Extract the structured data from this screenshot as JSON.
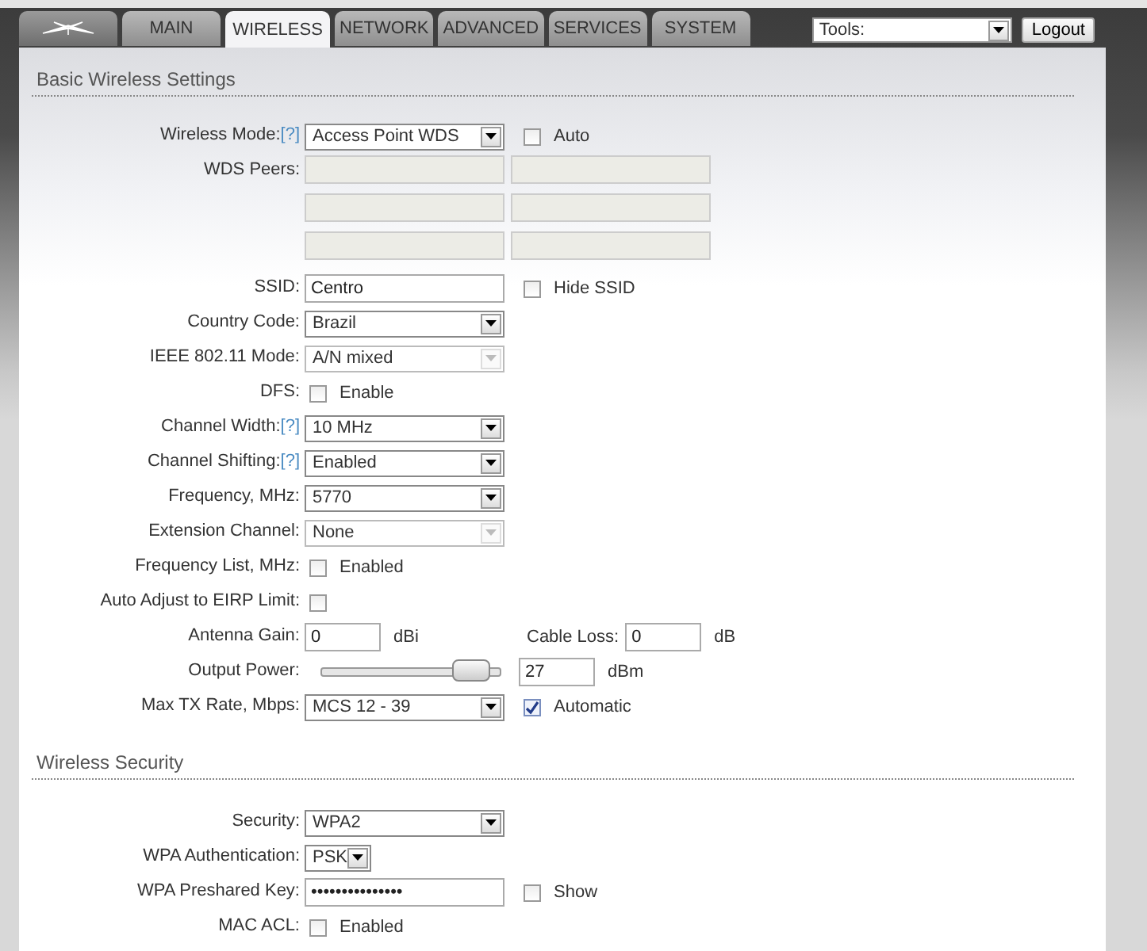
{
  "tabs": [
    {
      "kind": "logo",
      "selected": false
    },
    {
      "kind": "text",
      "label": "MAIN",
      "selected": false
    },
    {
      "kind": "text",
      "label": "WIRELESS",
      "selected": true
    },
    {
      "kind": "text",
      "label": "NETWORK",
      "selected": false
    },
    {
      "kind": "text",
      "label": "ADVANCED",
      "selected": false
    },
    {
      "kind": "text",
      "label": "SERVICES",
      "selected": false
    },
    {
      "kind": "text",
      "label": "SYSTEM",
      "selected": false
    }
  ],
  "tools": {
    "value": "Tools:"
  },
  "logout": "Logout",
  "sections": [
    {
      "title": "Basic Wireless Settings",
      "rows": [
        {
          "kind": "select",
          "label": "Wireless Mode:",
          "help": "[?]",
          "value": "Access Point WDS",
          "disabled": false,
          "option": {
            "label": "Auto",
            "checked": false
          }
        },
        {
          "kind": "peers",
          "label": "WDS Peers:",
          "peers": [
            {
              "disabled": true
            },
            {
              "disabled": true
            },
            {
              "disabled": true
            },
            {
              "disabled": true
            },
            {
              "disabled": true
            },
            {
              "disabled": true
            }
          ]
        },
        {
          "kind": "text",
          "label": "SSID:",
          "value": "Centro",
          "option": {
            "label": "Hide SSID",
            "checked": false
          }
        },
        {
          "kind": "select",
          "label": "Country Code:",
          "value": "Brazil",
          "disabled": false
        },
        {
          "kind": "select",
          "label": "IEEE 802.11 Mode:",
          "value": "A/N mixed",
          "disabled": true
        },
        {
          "kind": "checkbox",
          "label": "DFS:",
          "option": {
            "label": "Enable",
            "checked": false
          }
        },
        {
          "kind": "select",
          "label": "Channel Width:",
          "help": "[?]",
          "value": "10 MHz",
          "disabled": false
        },
        {
          "kind": "select",
          "label": "Channel Shifting:",
          "help": "[?]",
          "value": "Enabled",
          "disabled": false
        },
        {
          "kind": "select",
          "label": "Frequency, MHz:",
          "value": "5770",
          "disabled": false
        },
        {
          "kind": "select",
          "label": "Extension Channel:",
          "value": "None",
          "disabled": true
        },
        {
          "kind": "checkbox",
          "label": "Frequency List, MHz:",
          "option": {
            "label": "Enabled",
            "checked": false
          }
        },
        {
          "kind": "checkbox",
          "label": "Auto Adjust to EIRP Limit:",
          "option": {
            "checked": false
          }
        },
        {
          "kind": "pair",
          "label": "Antenna Gain:",
          "value": "0",
          "unit": "dBi",
          "label2": "Cable Loss:",
          "value2": "0",
          "unit2": "dB"
        },
        {
          "kind": "slider",
          "label": "Output Power:",
          "level": 0.95,
          "value": "27",
          "unit": "dBm"
        },
        {
          "kind": "select",
          "label": "Max TX Rate, Mbps:",
          "value": "MCS 12 - 39",
          "disabled": false,
          "option": {
            "label": "Automatic",
            "checked": true
          }
        }
      ]
    },
    {
      "title": "Wireless Security",
      "rows": [
        {
          "kind": "select",
          "label": "Security:",
          "value": "WPA2",
          "disabled": false
        },
        {
          "kind": "small_select",
          "label": "WPA Authentication:",
          "value": "PSK",
          "disabled": false
        },
        {
          "kind": "text",
          "label": "WPA Preshared Key:",
          "value": "•••••••••••••••",
          "option": {
            "label": "Show",
            "checked": false
          }
        },
        {
          "kind": "checkbox",
          "label": "MAC ACL:",
          "option": {
            "label": "Enabled",
            "checked": false
          }
        }
      ]
    }
  ]
}
